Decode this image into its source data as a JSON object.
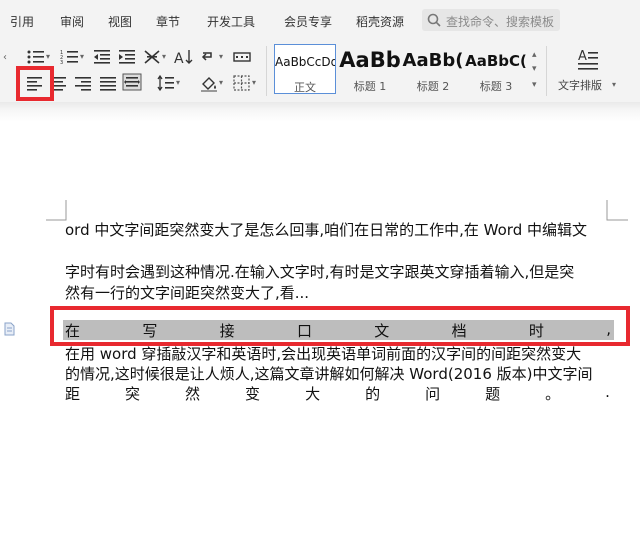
{
  "menu": {
    "items": [
      "引用",
      "审阅",
      "视图",
      "章节",
      "开发工具",
      "会员专享",
      "稻壳资源"
    ],
    "search_placeholder": "查找命令、搜索模板"
  },
  "styles": [
    {
      "sample": "AaBbCcDd",
      "name": "正文"
    },
    {
      "sample": "AaBb",
      "name": "标题 1"
    },
    {
      "sample": "AaBb(",
      "name": "标题 2"
    },
    {
      "sample": "AaBbC(",
      "name": "标题 3"
    }
  ],
  "text_layout_label": "文字排版",
  "document": {
    "line1": "ord 中文字间距突然变大了是怎么回事,咱们在日常的工作中,在 Word 中编辑文",
    "line2": "字时有时会遇到这种情况.在输入文字时,有时是文字跟英文穿插着输入,但是突",
    "line3": "然有一行的文字间距突然变大了,看...",
    "selected_chars": [
      "在",
      "写",
      "接",
      "口",
      "文",
      "档",
      "时",
      ","
    ],
    "line5": "在用 word 穿插敲汉字和英语时,会出现英语单词前面的汉字间的间距突然变大",
    "line6": "的情况,这时候很是让人烦人,这篇文章讲解如何解决 Word(2016 版本)中文字间",
    "line7_chars": [
      "距",
      "突",
      "然",
      "变",
      "大",
      "的",
      "问",
      "题",
      "。",
      "."
    ]
  },
  "colors": {
    "highlight": "#e8292f",
    "selection": "#bdbdbd",
    "active_style_border": "#5b8fd8"
  }
}
